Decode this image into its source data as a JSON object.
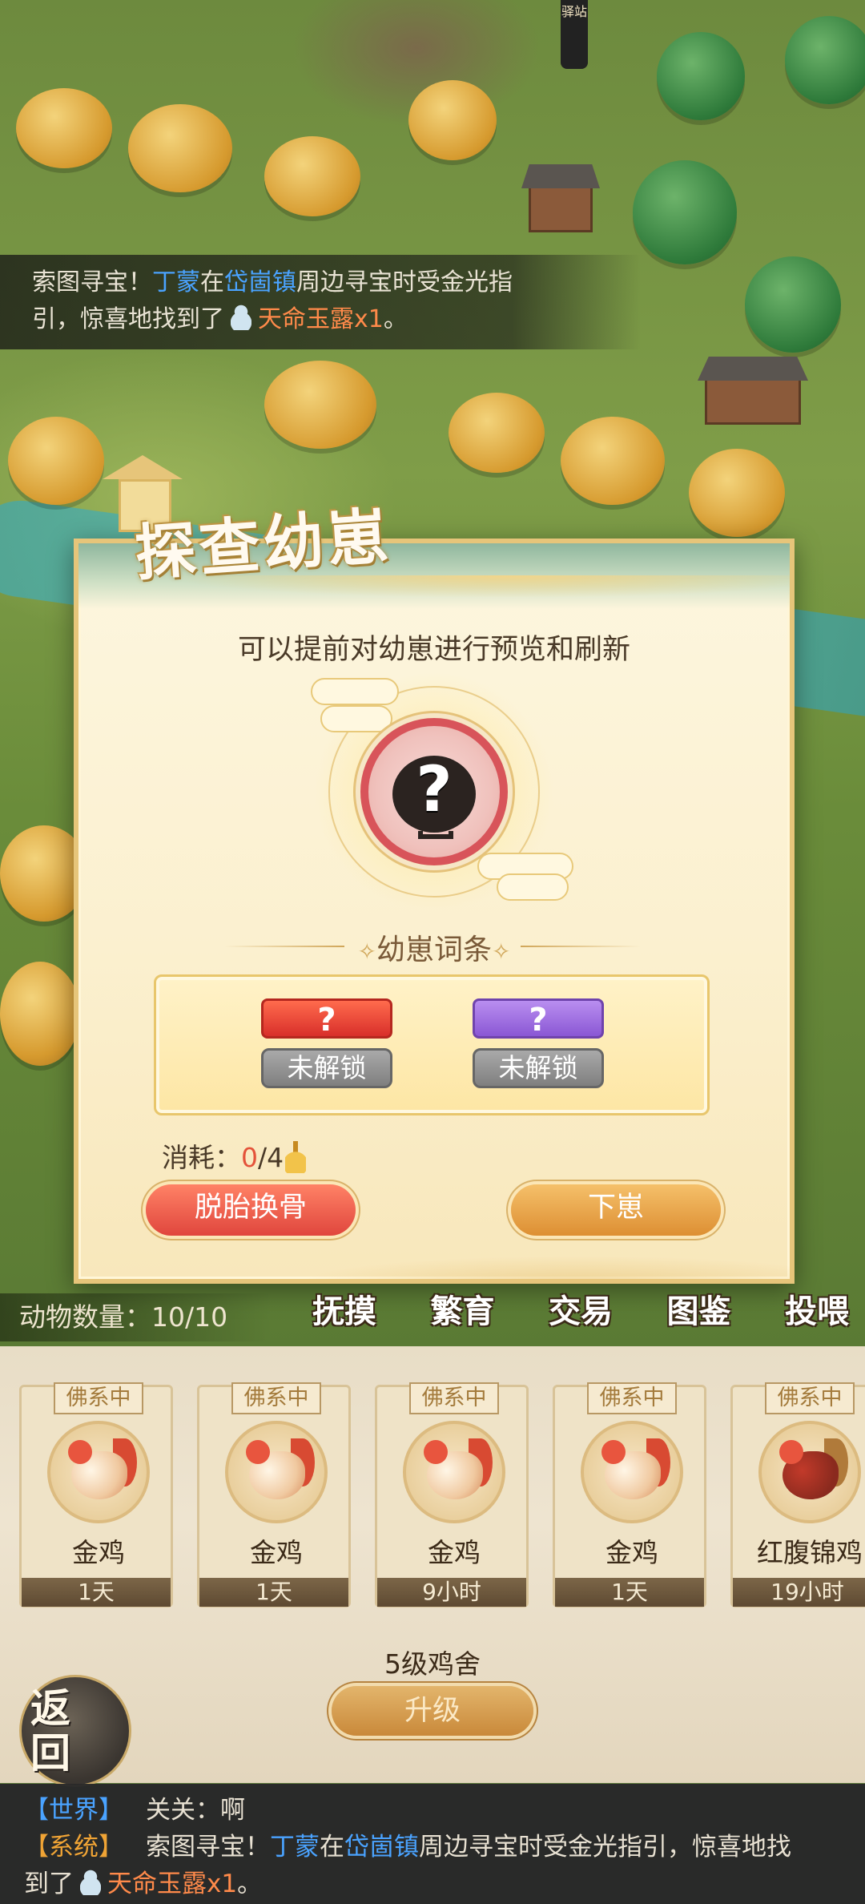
{
  "map": {
    "station_sign": "驿站"
  },
  "notice": {
    "prefix": "索图寻宝！",
    "name": "丁蒙",
    "mid1": "在",
    "place": "岱崮镇",
    "mid2": "周边寻宝时受金光指",
    "line2_start": "引，惊喜地找到了",
    "item": "天命玉露x1",
    "end": "。"
  },
  "dialog": {
    "title": "探查幼崽",
    "subtitle": "可以提前对幼崽进行预览和刷新",
    "preview_unknown": "?",
    "section_label": "幼崽词条",
    "section_ornament": "✧",
    "traits": [
      {
        "value": "?",
        "color": "red",
        "status": "未解锁"
      },
      {
        "value": "?",
        "color": "purple",
        "status": "未解锁"
      }
    ],
    "cost_label": "消耗：",
    "cost_current": "0",
    "cost_total": "/4",
    "reroll_button": "脱胎换骨",
    "confirm_button": "下崽"
  },
  "hud": {
    "animal_count": "动物数量：10/10",
    "actions": [
      "抚摸",
      "繁育",
      "交易",
      "图鉴",
      "投喂"
    ]
  },
  "animals": [
    {
      "tag": "佛系中",
      "name": "金鸡",
      "time": "1天",
      "kind": "hen"
    },
    {
      "tag": "佛系中",
      "name": "金鸡",
      "time": "1天",
      "kind": "hen"
    },
    {
      "tag": "佛系中",
      "name": "金鸡",
      "time": "9小时",
      "kind": "hen"
    },
    {
      "tag": "佛系中",
      "name": "金鸡",
      "time": "1天",
      "kind": "hen"
    },
    {
      "tag": "佛系中",
      "name": "红腹锦鸡",
      "time": "19小时",
      "kind": "pheasant"
    }
  ],
  "coop": {
    "level_text": "5级鸡舍",
    "upgrade_button": "升级"
  },
  "back_button": {
    "line1": "返",
    "line2": "回"
  },
  "chat": {
    "world_channel": "【世界】",
    "world_user": "关关：",
    "world_msg": "啊",
    "system_channel": "【系统】",
    "sys_prefix": "索图寻宝！",
    "sys_name": "丁蒙",
    "sys_mid1": "在",
    "sys_place": "岱崮镇",
    "sys_mid2": "周边寻宝时受金光指引，惊喜地找",
    "sys_line2": "到了",
    "sys_item": "天命玉露x1",
    "sys_end": "。"
  }
}
